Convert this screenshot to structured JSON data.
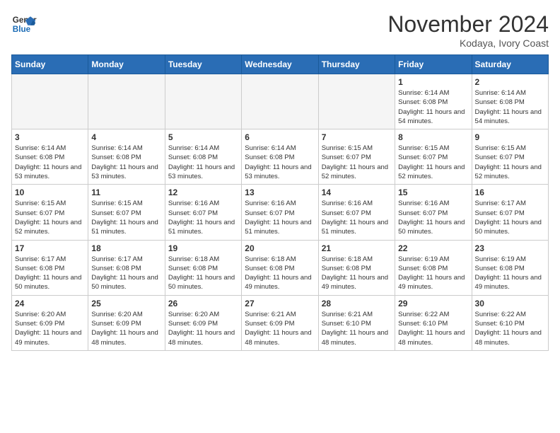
{
  "header": {
    "logo_line1": "General",
    "logo_line2": "Blue",
    "month": "November 2024",
    "location": "Kodaya, Ivory Coast"
  },
  "weekdays": [
    "Sunday",
    "Monday",
    "Tuesday",
    "Wednesday",
    "Thursday",
    "Friday",
    "Saturday"
  ],
  "weeks": [
    [
      {
        "day": "",
        "detail": "",
        "empty": true
      },
      {
        "day": "",
        "detail": "",
        "empty": true
      },
      {
        "day": "",
        "detail": "",
        "empty": true
      },
      {
        "day": "",
        "detail": "",
        "empty": true
      },
      {
        "day": "",
        "detail": "",
        "empty": true
      },
      {
        "day": "1",
        "detail": "Sunrise: 6:14 AM\nSunset: 6:08 PM\nDaylight: 11 hours\nand 54 minutes.",
        "empty": false
      },
      {
        "day": "2",
        "detail": "Sunrise: 6:14 AM\nSunset: 6:08 PM\nDaylight: 11 hours\nand 54 minutes.",
        "empty": false
      }
    ],
    [
      {
        "day": "3",
        "detail": "Sunrise: 6:14 AM\nSunset: 6:08 PM\nDaylight: 11 hours\nand 53 minutes.",
        "empty": false
      },
      {
        "day": "4",
        "detail": "Sunrise: 6:14 AM\nSunset: 6:08 PM\nDaylight: 11 hours\nand 53 minutes.",
        "empty": false
      },
      {
        "day": "5",
        "detail": "Sunrise: 6:14 AM\nSunset: 6:08 PM\nDaylight: 11 hours\nand 53 minutes.",
        "empty": false
      },
      {
        "day": "6",
        "detail": "Sunrise: 6:14 AM\nSunset: 6:08 PM\nDaylight: 11 hours\nand 53 minutes.",
        "empty": false
      },
      {
        "day": "7",
        "detail": "Sunrise: 6:15 AM\nSunset: 6:07 PM\nDaylight: 11 hours\nand 52 minutes.",
        "empty": false
      },
      {
        "day": "8",
        "detail": "Sunrise: 6:15 AM\nSunset: 6:07 PM\nDaylight: 11 hours\nand 52 minutes.",
        "empty": false
      },
      {
        "day": "9",
        "detail": "Sunrise: 6:15 AM\nSunset: 6:07 PM\nDaylight: 11 hours\nand 52 minutes.",
        "empty": false
      }
    ],
    [
      {
        "day": "10",
        "detail": "Sunrise: 6:15 AM\nSunset: 6:07 PM\nDaylight: 11 hours\nand 52 minutes.",
        "empty": false
      },
      {
        "day": "11",
        "detail": "Sunrise: 6:15 AM\nSunset: 6:07 PM\nDaylight: 11 hours\nand 51 minutes.",
        "empty": false
      },
      {
        "day": "12",
        "detail": "Sunrise: 6:16 AM\nSunset: 6:07 PM\nDaylight: 11 hours\nand 51 minutes.",
        "empty": false
      },
      {
        "day": "13",
        "detail": "Sunrise: 6:16 AM\nSunset: 6:07 PM\nDaylight: 11 hours\nand 51 minutes.",
        "empty": false
      },
      {
        "day": "14",
        "detail": "Sunrise: 6:16 AM\nSunset: 6:07 PM\nDaylight: 11 hours\nand 51 minutes.",
        "empty": false
      },
      {
        "day": "15",
        "detail": "Sunrise: 6:16 AM\nSunset: 6:07 PM\nDaylight: 11 hours\nand 50 minutes.",
        "empty": false
      },
      {
        "day": "16",
        "detail": "Sunrise: 6:17 AM\nSunset: 6:07 PM\nDaylight: 11 hours\nand 50 minutes.",
        "empty": false
      }
    ],
    [
      {
        "day": "17",
        "detail": "Sunrise: 6:17 AM\nSunset: 6:08 PM\nDaylight: 11 hours\nand 50 minutes.",
        "empty": false
      },
      {
        "day": "18",
        "detail": "Sunrise: 6:17 AM\nSunset: 6:08 PM\nDaylight: 11 hours\nand 50 minutes.",
        "empty": false
      },
      {
        "day": "19",
        "detail": "Sunrise: 6:18 AM\nSunset: 6:08 PM\nDaylight: 11 hours\nand 50 minutes.",
        "empty": false
      },
      {
        "day": "20",
        "detail": "Sunrise: 6:18 AM\nSunset: 6:08 PM\nDaylight: 11 hours\nand 49 minutes.",
        "empty": false
      },
      {
        "day": "21",
        "detail": "Sunrise: 6:18 AM\nSunset: 6:08 PM\nDaylight: 11 hours\nand 49 minutes.",
        "empty": false
      },
      {
        "day": "22",
        "detail": "Sunrise: 6:19 AM\nSunset: 6:08 PM\nDaylight: 11 hours\nand 49 minutes.",
        "empty": false
      },
      {
        "day": "23",
        "detail": "Sunrise: 6:19 AM\nSunset: 6:08 PM\nDaylight: 11 hours\nand 49 minutes.",
        "empty": false
      }
    ],
    [
      {
        "day": "24",
        "detail": "Sunrise: 6:20 AM\nSunset: 6:09 PM\nDaylight: 11 hours\nand 49 minutes.",
        "empty": false
      },
      {
        "day": "25",
        "detail": "Sunrise: 6:20 AM\nSunset: 6:09 PM\nDaylight: 11 hours\nand 48 minutes.",
        "empty": false
      },
      {
        "day": "26",
        "detail": "Sunrise: 6:20 AM\nSunset: 6:09 PM\nDaylight: 11 hours\nand 48 minutes.",
        "empty": false
      },
      {
        "day": "27",
        "detail": "Sunrise: 6:21 AM\nSunset: 6:09 PM\nDaylight: 11 hours\nand 48 minutes.",
        "empty": false
      },
      {
        "day": "28",
        "detail": "Sunrise: 6:21 AM\nSunset: 6:10 PM\nDaylight: 11 hours\nand 48 minutes.",
        "empty": false
      },
      {
        "day": "29",
        "detail": "Sunrise: 6:22 AM\nSunset: 6:10 PM\nDaylight: 11 hours\nand 48 minutes.",
        "empty": false
      },
      {
        "day": "30",
        "detail": "Sunrise: 6:22 AM\nSunset: 6:10 PM\nDaylight: 11 hours\nand 48 minutes.",
        "empty": false
      }
    ]
  ]
}
